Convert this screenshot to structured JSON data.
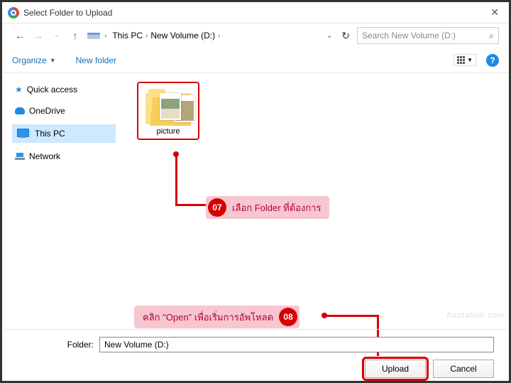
{
  "window": {
    "title": "Select Folder to Upload"
  },
  "breadcrumbs": {
    "root": "This PC",
    "drive": "New Volume (D:)"
  },
  "search": {
    "placeholder": "Search New Volume (D:)"
  },
  "toolbar": {
    "organize": "Organize",
    "newfolder": "New folder"
  },
  "sidebar": {
    "quick": "Quick access",
    "onedrive": "OneDrive",
    "thispc": "This PC",
    "network": "Network"
  },
  "items": {
    "pictureFolder": "picture"
  },
  "annotations": {
    "step07num": "07",
    "step07text": "เลือก Folder ที่ต้องการ",
    "step08text": "คลิก \"Open\" เพื่อเริ่มการอัพโหลด",
    "step08num": "08"
  },
  "bottom": {
    "folderLabel": "Folder:",
    "folderValue": "New Volume (D:)",
    "upload": "Upload",
    "cancel": "Cancel"
  },
  "watermark": "hostatom.com"
}
